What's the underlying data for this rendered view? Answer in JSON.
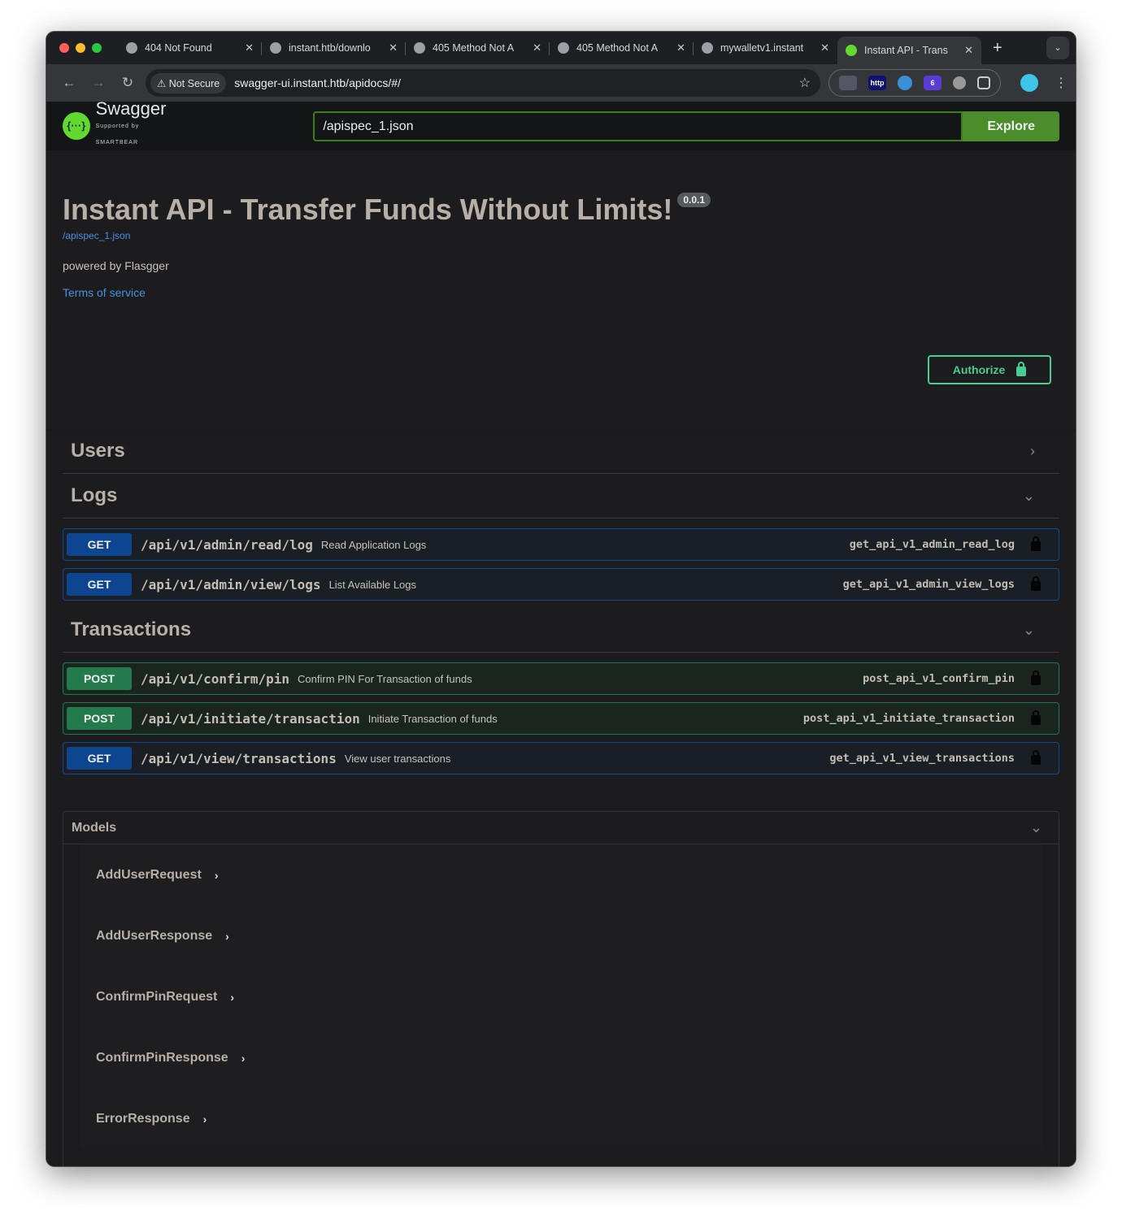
{
  "browser": {
    "tabs": [
      {
        "title": "404 Not Found"
      },
      {
        "title": "instant.htb/downlo"
      },
      {
        "title": "405 Method Not A"
      },
      {
        "title": "405 Method Not A"
      },
      {
        "title": "mywalletv1.instant"
      },
      {
        "title": "Instant API - Trans",
        "active": true
      }
    ],
    "security": "Not Secure",
    "url": "swagger-ui.instant.htb/apidocs/#/",
    "extensions": [
      "spy-icon",
      "http-icon",
      "v-icon",
      "stack-icon",
      "cmd-icon",
      "puzzle-icon"
    ],
    "ext_badges": {
      "http": "http",
      "count": "6"
    }
  },
  "swagger": {
    "brand": "Swagger",
    "brand_sub": "Supported by SMARTBEAR",
    "spec_url": "/apispec_1.json",
    "explore_label": "Explore",
    "title": "Instant API - Transfer Funds Without Limits!",
    "version": "0.0.1",
    "spec_link": "/apispec_1.json",
    "powered_by": "powered by Flasgger",
    "terms": "Terms of service",
    "authorize_label": "Authorize",
    "tags": [
      {
        "name": "Users",
        "expanded": false,
        "ops": []
      },
      {
        "name": "Logs",
        "expanded": true,
        "ops": [
          {
            "method": "GET",
            "path": "/api/v1/admin/read/log",
            "summary": "Read Application Logs",
            "operation_id": "get_api_v1_admin_read_log"
          },
          {
            "method": "GET",
            "path": "/api/v1/admin/view/logs",
            "summary": "List Available Logs",
            "operation_id": "get_api_v1_admin_view_logs"
          }
        ]
      },
      {
        "name": "Transactions",
        "expanded": true,
        "ops": [
          {
            "method": "POST",
            "path": "/api/v1/confirm/pin",
            "summary": "Confirm PIN For Transaction of funds",
            "operation_id": "post_api_v1_confirm_pin"
          },
          {
            "method": "POST",
            "path": "/api/v1/initiate/transaction",
            "summary": "Initiate Transaction of funds",
            "operation_id": "post_api_v1_initiate_transaction"
          },
          {
            "method": "GET",
            "path": "/api/v1/view/transactions",
            "summary": "View user transactions",
            "operation_id": "get_api_v1_view_transactions"
          }
        ]
      }
    ],
    "models_label": "Models",
    "models": [
      "AddUserRequest",
      "AddUserResponse",
      "ConfirmPinRequest",
      "ConfirmPinResponse",
      "ErrorResponse"
    ],
    "colors": {
      "get": "#0d4591",
      "post": "#237a4d",
      "authorize": "#49cc90",
      "link": "#4990e2"
    }
  }
}
